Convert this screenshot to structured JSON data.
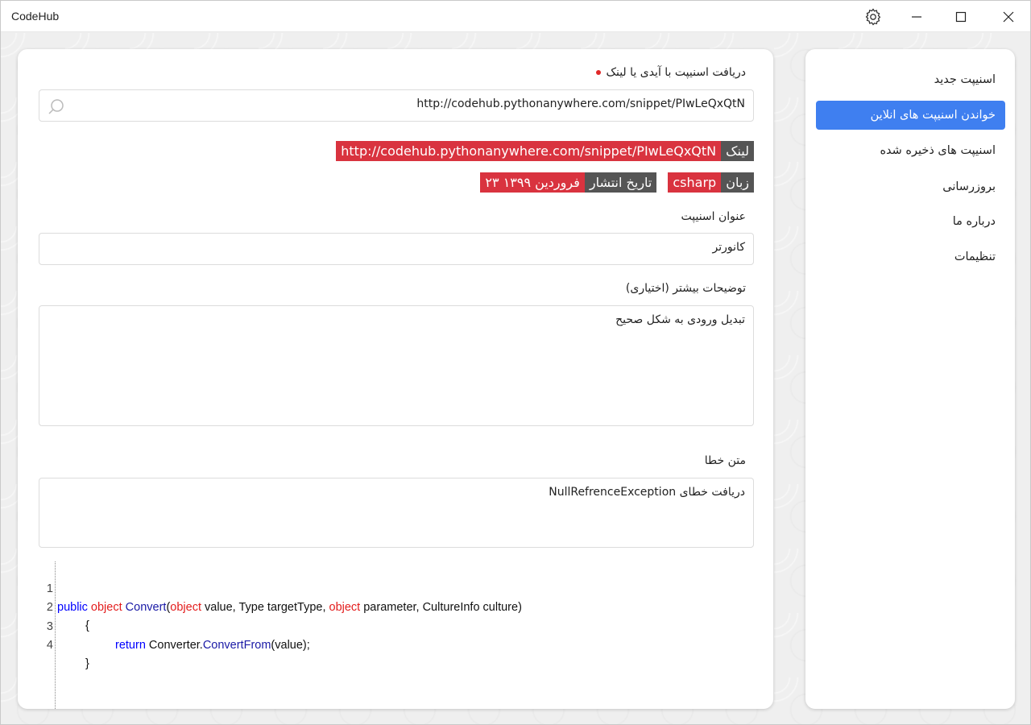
{
  "app": {
    "title": "CodeHub"
  },
  "window_controls": {
    "settings_icon": "gear-icon",
    "minimize_icon": "minimize-icon",
    "maximize_icon": "maximize-icon",
    "close_icon": "close-icon"
  },
  "colors": {
    "accent": "#3f7ff0",
    "tag_red": "#d9333f",
    "tag_dark": "#555555",
    "required_dot": "#e02828"
  },
  "fetch": {
    "label": "دریافت اسنیپت با آیدی یا لینک",
    "value": "http://codehub.pythonanywhere.com/snippet/PIwLeQxQtN",
    "icon": "search-icon"
  },
  "meta": {
    "link_label": "لینک",
    "link_value": "http://codehub.pythonanywhere.com/snippet/PIwLeQxQtN",
    "lang_label": "زبان",
    "lang_value": "csharp",
    "date_label": "تاریخ انتشار",
    "date_value": "۲۳ فروردین ۱۳۹۹"
  },
  "title_field": {
    "label": "عنوان اسنیپت",
    "value": "کانورتر"
  },
  "description_field": {
    "label": "توضیحات بیشتر (اختیاری)",
    "value": "تبدیل ورودی به شکل صحیح"
  },
  "error_field": {
    "label": "متن خطا",
    "value": "دریافت خطای NullRefrenceException"
  },
  "code": {
    "line_numbers": [
      "1",
      "2",
      "3",
      "4"
    ],
    "line1": {
      "t1": "public",
      "t2": " ",
      "t3": "object",
      "t4": " ",
      "t5": "Convert",
      "t6": "(",
      "t7": "object",
      "t8": " value, Type targetType, ",
      "t9": "object",
      "t10": " parameter, CultureInfo culture)"
    },
    "line2": "{",
    "line3": {
      "t1": "return",
      "t2": " Converter.",
      "t3": "ConvertFrom",
      "t4": "(value);"
    },
    "line4": "}"
  },
  "sidebar": {
    "items": [
      {
        "label": "اسنیپت جدید"
      },
      {
        "label": "خواندن اسنیپت های انلاین"
      },
      {
        "label": "اسنیپت های ذخیره شده"
      },
      {
        "label": "بروزرسانی"
      },
      {
        "label": "درباره ما"
      },
      {
        "label": "تنظیمات"
      }
    ]
  }
}
